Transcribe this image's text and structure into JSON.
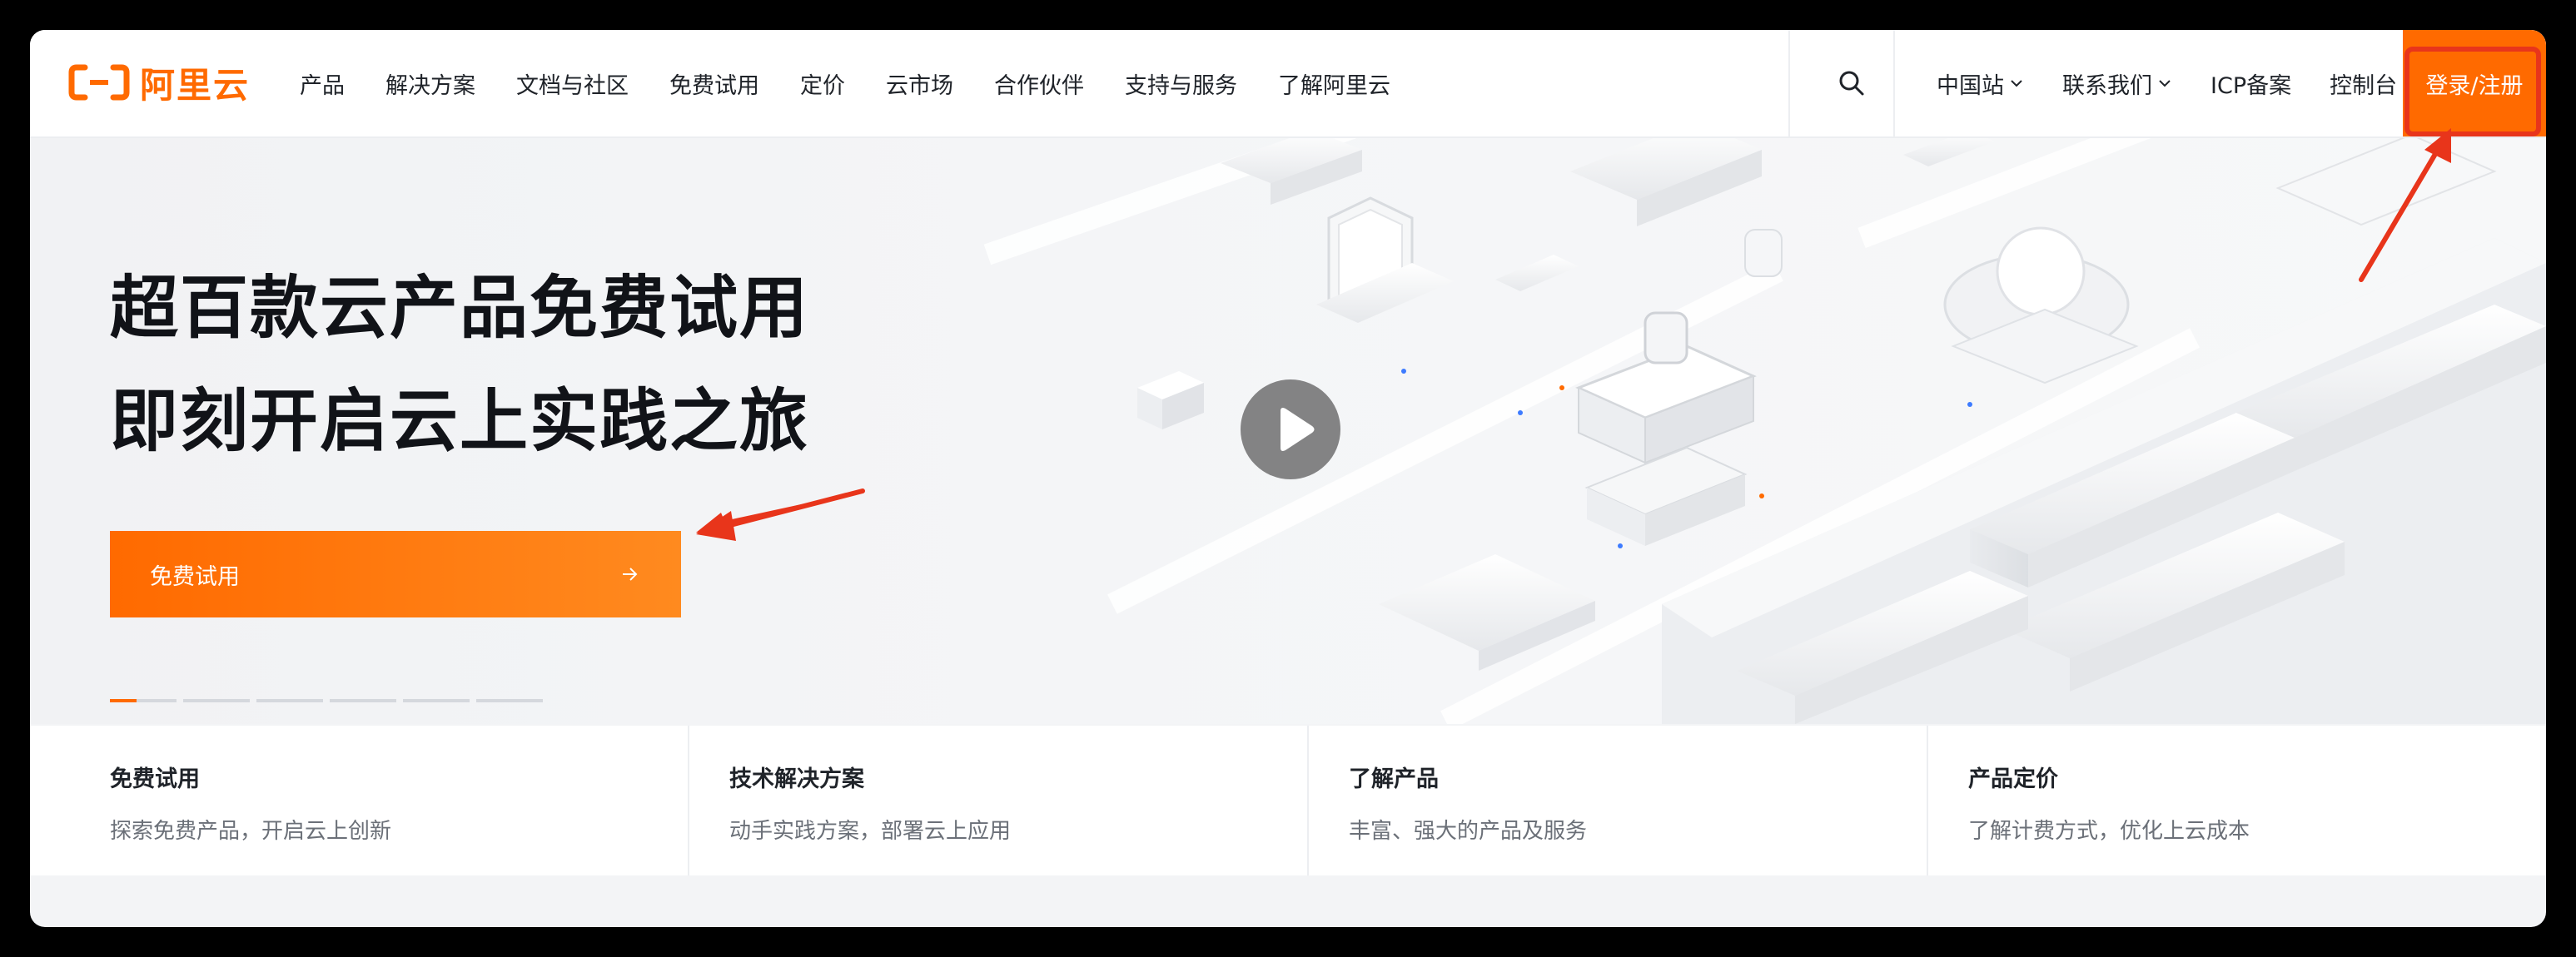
{
  "brand": {
    "name": "阿里云",
    "color": "#ff6a00"
  },
  "nav": {
    "menu": [
      {
        "label": "产品"
      },
      {
        "label": "解决方案"
      },
      {
        "label": "文档与社区"
      },
      {
        "label": "免费试用"
      },
      {
        "label": "定价"
      },
      {
        "label": "云市场"
      },
      {
        "label": "合作伙伴"
      },
      {
        "label": "支持与服务"
      },
      {
        "label": "了解阿里云"
      }
    ],
    "search_icon": "search-icon",
    "region_label": "中国站",
    "contact_label": "联系我们",
    "icp_label": "ICP备案",
    "console_label": "控制台",
    "login_label": "登录/注册"
  },
  "hero": {
    "title_line1": "超百款云产品免费试用",
    "title_line2": "即刻开启云上实践之旅",
    "cta_label": "免费试用",
    "cta_icon": "arrow-right-icon",
    "play_icon": "play-icon",
    "slide_count": 6,
    "active_slide": 1
  },
  "cards": [
    {
      "title": "免费试用",
      "desc": "探索免费产品，开启云上创新"
    },
    {
      "title": "技术解决方案",
      "desc": "动手实践方案，部署云上应用"
    },
    {
      "title": "了解产品",
      "desc": "丰富、强大的产品及服务"
    },
    {
      "title": "产品定价",
      "desc": "了解计费方式，优化上云成本"
    }
  ],
  "colors": {
    "accent": "#ff6a00",
    "annotation": "#e8351b"
  }
}
